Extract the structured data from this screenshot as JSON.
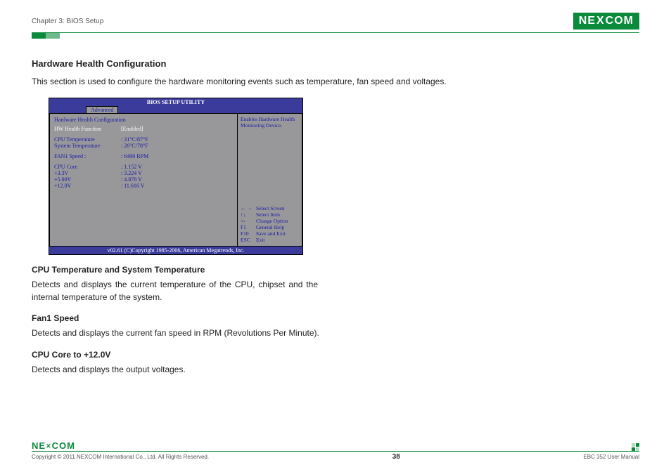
{
  "header": {
    "chapter": "Chapter 3: BIOS Setup",
    "brand": "NEXCOM"
  },
  "sections": {
    "hw_health_title": "Hardware Health Configuration",
    "hw_health_body": "This section is used to configure the hardware monitoring events such as temperature, fan speed and voltages.",
    "cpu_temp_title": "CPU Temperature and System Temperature",
    "cpu_temp_body": "Detects and displays the current temperature of the CPU, chipset and the internal temperature of the system.",
    "fan1_title": "Fan1 Speed",
    "fan1_body": "Detects and displays the current fan speed in RPM (Revolutions Per Minute).",
    "volt_title": "CPU Core to +12.0V",
    "volt_body": "Detects and displays the output voltages."
  },
  "bios": {
    "title": "BIOS SETUP UTILITY",
    "tab": "Advanced",
    "heading": "Hardware Health Configuration",
    "selected": {
      "label": "HW Health Function",
      "value": "[Enabled]"
    },
    "rows1": [
      {
        "label": "CPU Temperature",
        "value": ": 31°C/87°F"
      },
      {
        "label": "System Temperature",
        "value": ": 26°C/78°F"
      }
    ],
    "rows2": [
      {
        "label": "FAN1 Speed        :",
        "value": ": 6490 RPM"
      }
    ],
    "rows3": [
      {
        "label": "CPU Core",
        "value": ": 1.152 V"
      },
      {
        "label": "+3.3V",
        "value": ": 3.224 V"
      },
      {
        "label": "+5.00V",
        "value": ": 4.878 V"
      },
      {
        "label": "+12.0V",
        "value": ": 11.616 V"
      }
    ],
    "help": "Enables Hardware Health Monitoring Device.",
    "keys": [
      {
        "k": "← →",
        "d": "Select Screen"
      },
      {
        "k": "↑↓",
        "d": "Select Item"
      },
      {
        "k": "+-",
        "d": "Change Option"
      },
      {
        "k": "F1",
        "d": "General Help"
      },
      {
        "k": "F10",
        "d": "Save and Exit"
      },
      {
        "k": "ESC",
        "d": "Exit"
      }
    ],
    "footer": "v02.61 (C)Copyright 1985-2006, American Megatrends, Inc."
  },
  "footer": {
    "brand": "NEXCOM",
    "copyright": "Copyright © 2011 NEXCOM International Co., Ltd. All Rights Reserved.",
    "page": "38",
    "manual": "EBC 352 User Manual"
  }
}
